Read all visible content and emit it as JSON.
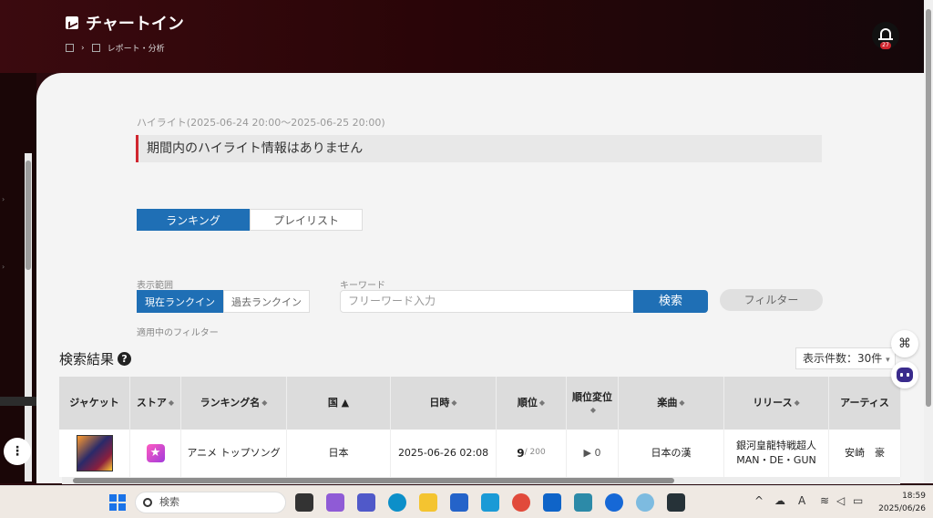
{
  "header": {
    "title": "チャートイン",
    "breadcrumb_page": "レポート・分析",
    "notification_count": "27"
  },
  "highlight": {
    "label": "ハイライト(2025-06-24 20:00～2025-06-25 20:00)",
    "message": "期間内のハイライト情報はありません"
  },
  "tabs": [
    "ランキング",
    "プレイリスト"
  ],
  "filters": {
    "range_label": "表示範囲",
    "range_options": [
      "現在ランクイン",
      "過去ランクイン"
    ],
    "keyword_label": "キーワード",
    "keyword_placeholder": "フリーワード入力",
    "search_button": "検索",
    "filter_button": "フィルター",
    "applied_label": "適用中のフィルター"
  },
  "results": {
    "title": "検索結果",
    "per_page": "表示件数：30件"
  },
  "table": {
    "headers": [
      "ジャケット",
      "ストア",
      "ランキング名",
      "国 ▲",
      "日時",
      "順位",
      "順位変位",
      "楽曲",
      "リリース",
      "アーティス"
    ],
    "rows": [
      {
        "ranking_name": "アニメ トップソング",
        "country": "日本",
        "datetime": "2025-06-26 02:08",
        "rank": "9",
        "rank_total": "/ 200",
        "rank_change": "▶ 0",
        "song": "日本の漢",
        "release": "銀河皇龍特戦超人MAN・DE・GUN",
        "artist": "安崎　豪"
      }
    ]
  },
  "taskbar": {
    "search": "検索",
    "time": "18:59",
    "date": "2025/06/26"
  },
  "icons": [
    "chart-logo-icon",
    "dashboard-icon",
    "document-icon",
    "bell-icon",
    "help-icon",
    "command-icon",
    "assistant-bot-icon",
    "menu-dots-icon",
    "windows-start-icon",
    "search-icon"
  ],
  "colors": {
    "accent": "#1f6fb5",
    "highlight_bar": "#d0262f",
    "header_bg": "#2a0508"
  }
}
